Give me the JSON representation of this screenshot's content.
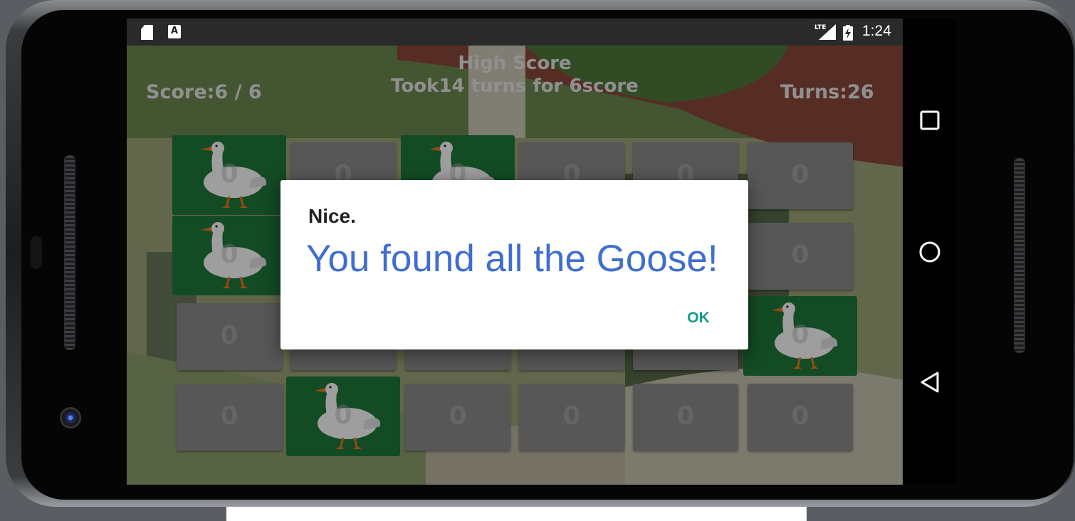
{
  "status_bar": {
    "time": "1:24",
    "network": "LTE",
    "left_icons": [
      "sd-card-icon",
      "a-notification-icon"
    ],
    "right_icons": [
      "lte-signal-icon",
      "battery-charging-icon"
    ]
  },
  "game": {
    "score_text": "Score:6 / 6",
    "turns_text": "Turns:26",
    "high_score_title": "High Score",
    "high_score_text": "Took14 turns for 6score",
    "card_value": "0",
    "grid": [
      [
        "goose",
        "hidden",
        "goose",
        "hidden",
        "hidden",
        "hidden"
      ],
      [
        "goose",
        "hidden",
        "hidden",
        "hidden",
        "hidden",
        "hidden"
      ],
      [
        "hidden",
        "hidden",
        "hidden",
        "hidden",
        "hidden",
        "goose"
      ],
      [
        "hidden",
        "goose",
        "hidden",
        "hidden",
        "hidden",
        "hidden"
      ]
    ]
  },
  "dialog": {
    "title": "Nice.",
    "message": "You found all the Goose!",
    "ok_label": "OK"
  },
  "nav_bar": {
    "buttons": [
      "recents-square-icon",
      "home-circle-icon",
      "back-triangle-icon"
    ]
  },
  "colors": {
    "dialog_message": "#3f6ed0",
    "dialog_button": "#139a8a",
    "open_card": "#1f7a3c",
    "hidden_card": "#8d8d8d"
  }
}
